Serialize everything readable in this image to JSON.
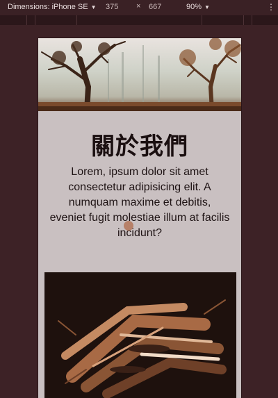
{
  "devtools": {
    "device_label": "Dimensions: iPhone SE",
    "width_value": "375",
    "times_symbol": "×",
    "height_value": "667",
    "zoom_label": "90%",
    "menu_icon": "vertical-ellipsis-icon"
  },
  "page": {
    "hero_image": "forest-trees-photo",
    "title": "關於我們",
    "intro_text": "Lorem, ipsum dolor sit amet consectetur adipisicing elit. A numquam maxime et debitis, eveniet fugit molestiae illum at facilis incidunt?",
    "photo_image": "firewood-pile-photo"
  },
  "colors": {
    "background": "#3d2226",
    "page_background": "#c9c0c1",
    "title": "#1a0f10",
    "accent_dot": "#b57a5f"
  }
}
